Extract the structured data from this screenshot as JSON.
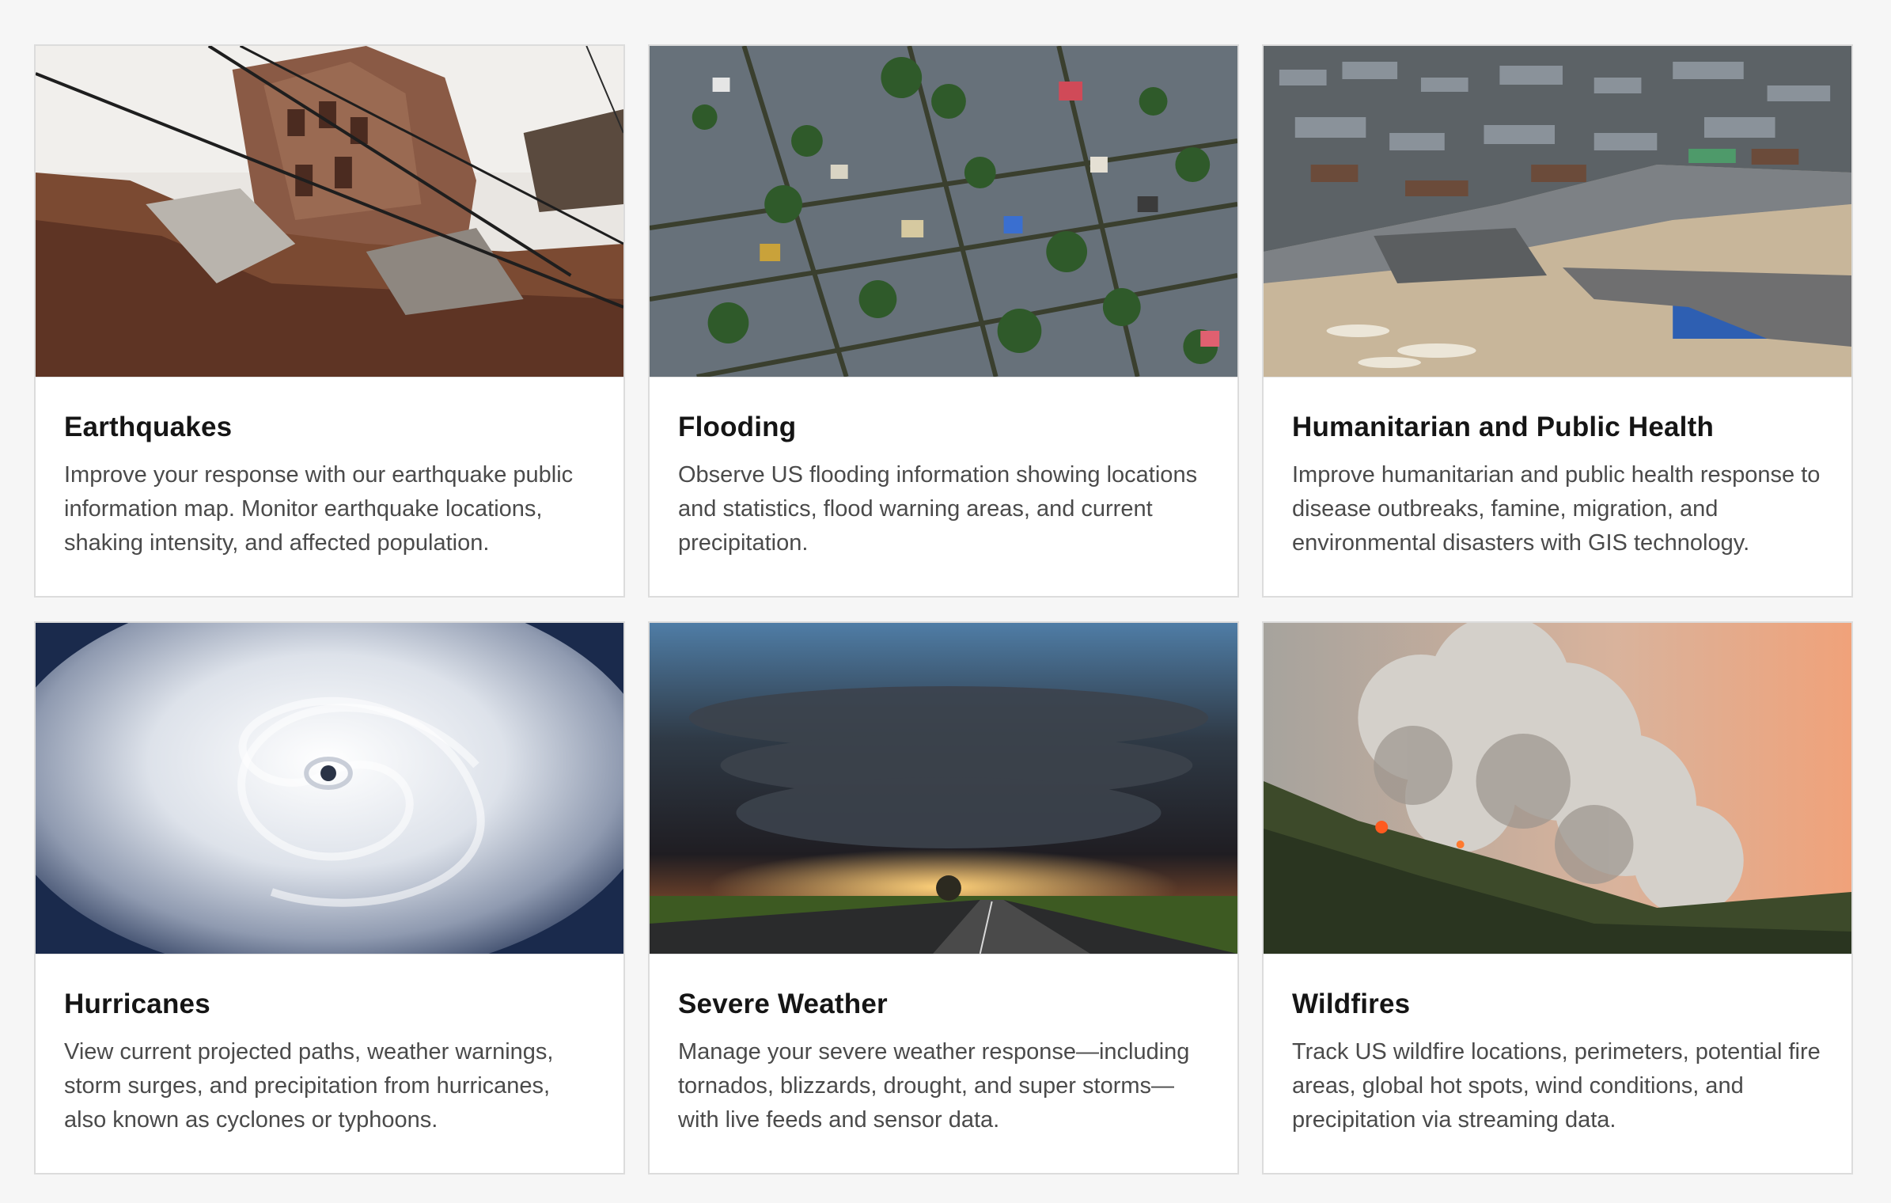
{
  "cards": [
    {
      "title": "Earthquakes",
      "description": "Improve your response with our earthquake public information map. Monitor earthquake locations, shaking intensity, and affected population."
    },
    {
      "title": "Flooding",
      "description": "Observe US flooding information showing locations and statistics, flood warning areas, and current precipitation."
    },
    {
      "title": "Humanitarian and Public Health",
      "description": "Improve humanitarian and public health response to disease outbreaks, famine, migration, and environmental disasters with GIS technology."
    },
    {
      "title": "Hurricanes",
      "description": "View current projected paths, weather warnings, storm surges, and precipitation from hurricanes, also known as cyclones or typhoons."
    },
    {
      "title": "Severe Weather",
      "description": "Manage your severe weather response—including tornados, blizzards, drought, and super storms—with live feeds and sensor data."
    },
    {
      "title": "Wildfires",
      "description": "Track US wildfire locations, perimeters, potential fire areas, global hot spots, wind conditions, and precipitation via streaming data."
    }
  ]
}
